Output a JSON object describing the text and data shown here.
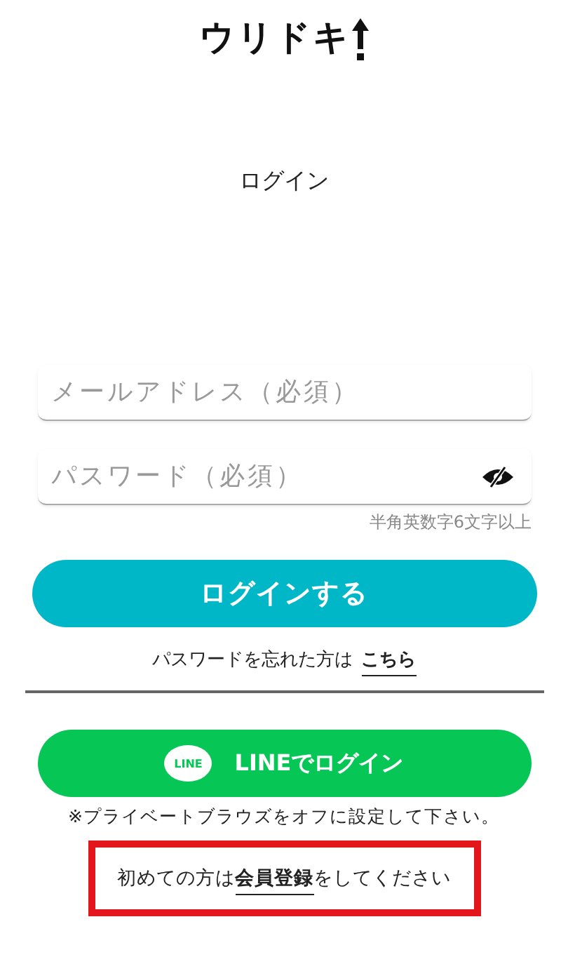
{
  "logo": {
    "text": "ウリドキ"
  },
  "title": "ログイン",
  "fields": [
    {
      "placeholder": "メールアドレス（必須）",
      "kind": "text"
    },
    {
      "placeholder": "パスワード（必須）",
      "kind": "password"
    }
  ],
  "password_hint": "半角英数字6文字以上",
  "login_button": "ログインする",
  "forgot": {
    "text": "パスワードを忘れた方は",
    "link": "こちら"
  },
  "line_button": {
    "badge": "LINE",
    "label": "LINEでログイン"
  },
  "notice": "※プライベートブラウズをオフに設定して下さい。",
  "register": {
    "before": "初めての方は",
    "link": "会員登録",
    "after": "をしてください"
  }
}
